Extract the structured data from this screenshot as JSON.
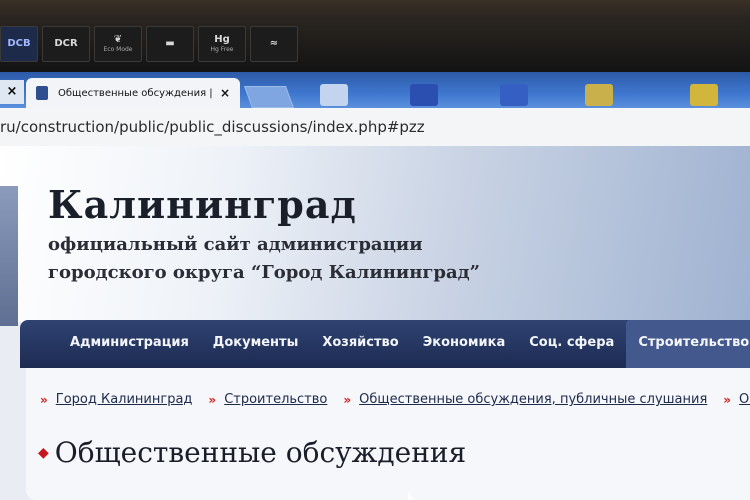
{
  "bezel": {
    "stickers": [
      {
        "big": "DCB",
        "small": ""
      },
      {
        "big": "DCR",
        "small": ""
      },
      {
        "big": "",
        "small": "Eco Mode"
      },
      {
        "big": "",
        "small": ""
      },
      {
        "big": "Hg",
        "small": "Hg Free"
      },
      {
        "big": "",
        "small": ""
      }
    ]
  },
  "browser": {
    "tab_title": "Общественные обсуждения | О",
    "tab_close": "×",
    "left_close": "×",
    "url": "ru/construction/public/public_discussions/index.php#pzz"
  },
  "site": {
    "title": "Калининград",
    "subtitle_line1": "официальный сайт администрации",
    "subtitle_line2": "городского округа “Город Калининград”",
    "nav": [
      {
        "label": "Администрация"
      },
      {
        "label": "Документы"
      },
      {
        "label": "Хозяйство"
      },
      {
        "label": "Экономика"
      },
      {
        "label": "Соц. сфера"
      },
      {
        "label": "Строительство"
      }
    ],
    "breadcrumbs": [
      {
        "label": "Город Калининград"
      },
      {
        "label": "Строительство"
      },
      {
        "label": "Общественные обсуждения, публичные слушания"
      },
      {
        "label": "Общ"
      }
    ],
    "breadcrumb_separator": "»",
    "page_heading": "Общественные обсуждения",
    "heading_marker": "◆"
  },
  "colors": {
    "nav_bg": "#1d2b52",
    "nav_active": "#43598e",
    "breadcrumb_arrow": "#d01a1a"
  }
}
